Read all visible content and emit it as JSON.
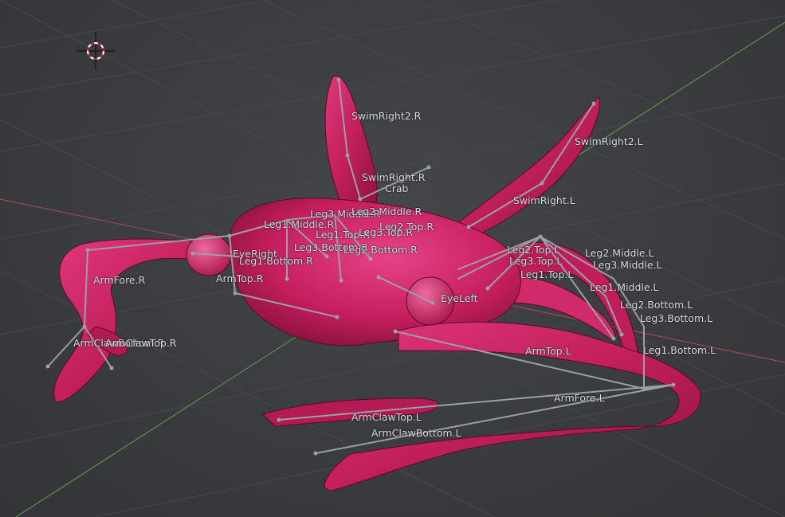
{
  "viewport": {
    "colors": {
      "background": "#3b3d40",
      "grid_line": "#46484c",
      "x_axis": "#9a4a56",
      "y_axis": "#5f8f49",
      "mesh": "#c8215e",
      "bone": "#9aa0a6",
      "label": "#d9dbe0"
    }
  },
  "bone_labels": [
    "SwimRight2.R",
    "SwimRight2.L",
    "SwimRight.R",
    "Crab",
    "SwimRight.L",
    "Leg3.Middle.R",
    "Leg2.Middle.R",
    "Leg1.Middle.R",
    "Leg2.Top.R",
    "Leg1.Top.R",
    "Leg3.Top.R",
    "Leg3.Bottom.R",
    "Leg2.Bottom.R",
    "EyeRight",
    "Leg1.Bottom.R",
    "ArmTop.R",
    "ArmFore.R",
    "ArmClawBottom.R",
    "ArmClawTop.R",
    "Leg2.Top.L",
    "Leg2.Middle.L",
    "Leg3.Top.L",
    "Leg3.Middle.L",
    "Leg1.Top.L",
    "Leg1.Middle.L",
    "EyeLeft",
    "Leg2.Bottom.L",
    "Leg3.Bottom.L",
    "ArmTop.L",
    "Leg1.Bottom.L",
    "ArmFore.L",
    "ArmClawTop.L",
    "ArmClawBottom.L"
  ]
}
